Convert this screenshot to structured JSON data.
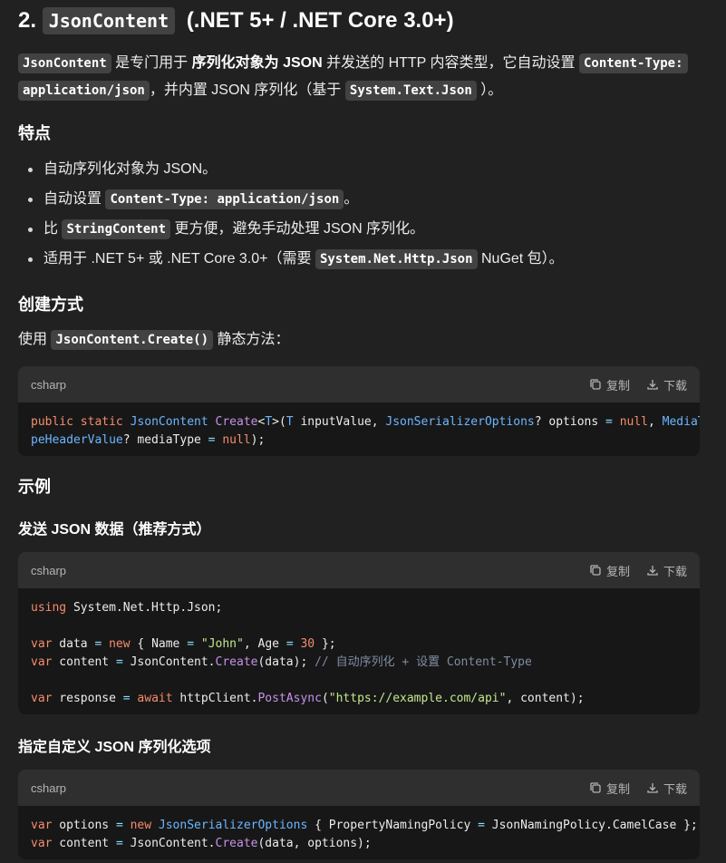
{
  "heading2": {
    "prefix": "2.",
    "code": "JsonContent",
    "suffix": "(.NET 5+ / .NET Core 3.0+)"
  },
  "intro": {
    "code1": "JsonContent",
    "t1": "是专门用于",
    "bold1": "序列化对象为 JSON",
    "t2": "并发送的 HTTP 内容类型，它自动设置",
    "code2a": "Content-Type:",
    "code2b": "application/json",
    "t3": "，并内置 JSON 序列化（基于",
    "code3": "System.Text.Json",
    "t4": "）。"
  },
  "features": {
    "title": "特点",
    "items": [
      {
        "text": "自动序列化对象为 JSON。"
      },
      {
        "pre": "自动设置",
        "code": "Content-Type: application/json",
        "post": "。"
      },
      {
        "pre": "比",
        "code": "StringContent",
        "post": "更方便，避免手动处理 JSON 序列化。"
      },
      {
        "pre": "适用于 .NET 5+ 或 .NET Core 3.0+（需要",
        "code": "System.Net.Http.Json",
        "post": "NuGet 包）。"
      }
    ]
  },
  "creation": {
    "title": "创建方式",
    "pre": "使用",
    "code": "JsonContent.Create()",
    "post": "静态方法："
  },
  "examples": {
    "title": "示例",
    "send_title": "发送 JSON 数据（推荐方式）",
    "custom_title": "指定自定义 JSON 序列化选项"
  },
  "codeblock": {
    "lang": "csharp",
    "copy": "复制",
    "download": "下载"
  },
  "code1": {
    "l1_a": "public",
    "l1_b": "static",
    "l1_c": "JsonContent",
    "l1_d": "Create",
    "l1_e": "<",
    "l1_f": "T",
    "l1_g": ">(",
    "l1_h": "T",
    "l1_i": " inputValue, ",
    "l1_j": "JsonSerializerOptions",
    "l1_k": "? options ",
    "l1_l": "=",
    "l1_m": "null",
    "l1_n": ", ",
    "l1_o": "MediaTy",
    "l2_a": "peHeaderValue",
    "l2_b": "? mediaType ",
    "l2_c": "=",
    "l2_d": "null",
    "l2_e": ");"
  },
  "code2": {
    "l1_kw": "using",
    "l1_rest": " System.Net.Http.Json;",
    "l3_var": "var",
    "l3_a": " data ",
    "l3_eq": "=",
    "l3_new": "new",
    "l3_b": " { Name ",
    "l3_eq2": "=",
    "l3_str": "\"John\"",
    "l3_c": ", Age ",
    "l3_eq3": "=",
    "l3_num": "30",
    "l3_d": " };",
    "l4_var": "var",
    "l4_a": " content ",
    "l4_eq": "=",
    "l4_b": " JsonContent.",
    "l4_fn": "Create",
    "l4_c": "(data); ",
    "l4_cm": "// 自动序列化 + 设置 Content-Type",
    "l6_var": "var",
    "l6_a": " response ",
    "l6_eq": "=",
    "l6_await": "await",
    "l6_b": " httpClient.",
    "l6_fn": "PostAsync",
    "l6_c": "(",
    "l6_str": "\"https://example.com/api\"",
    "l6_d": ", content);"
  },
  "code3": {
    "l1_var": "var",
    "l1_a": " options ",
    "l1_eq": "=",
    "l1_new": "new",
    "l1_ty": "JsonSerializerOptions",
    "l1_b": " { PropertyNamingPolicy ",
    "l1_eq2": "=",
    "l1_c": " JsonNamingPolicy.CamelCase };",
    "l2_var": "var",
    "l2_a": " content ",
    "l2_eq": "=",
    "l2_b": " JsonContent.",
    "l2_fn": "Create",
    "l2_c": "(data, options);"
  }
}
